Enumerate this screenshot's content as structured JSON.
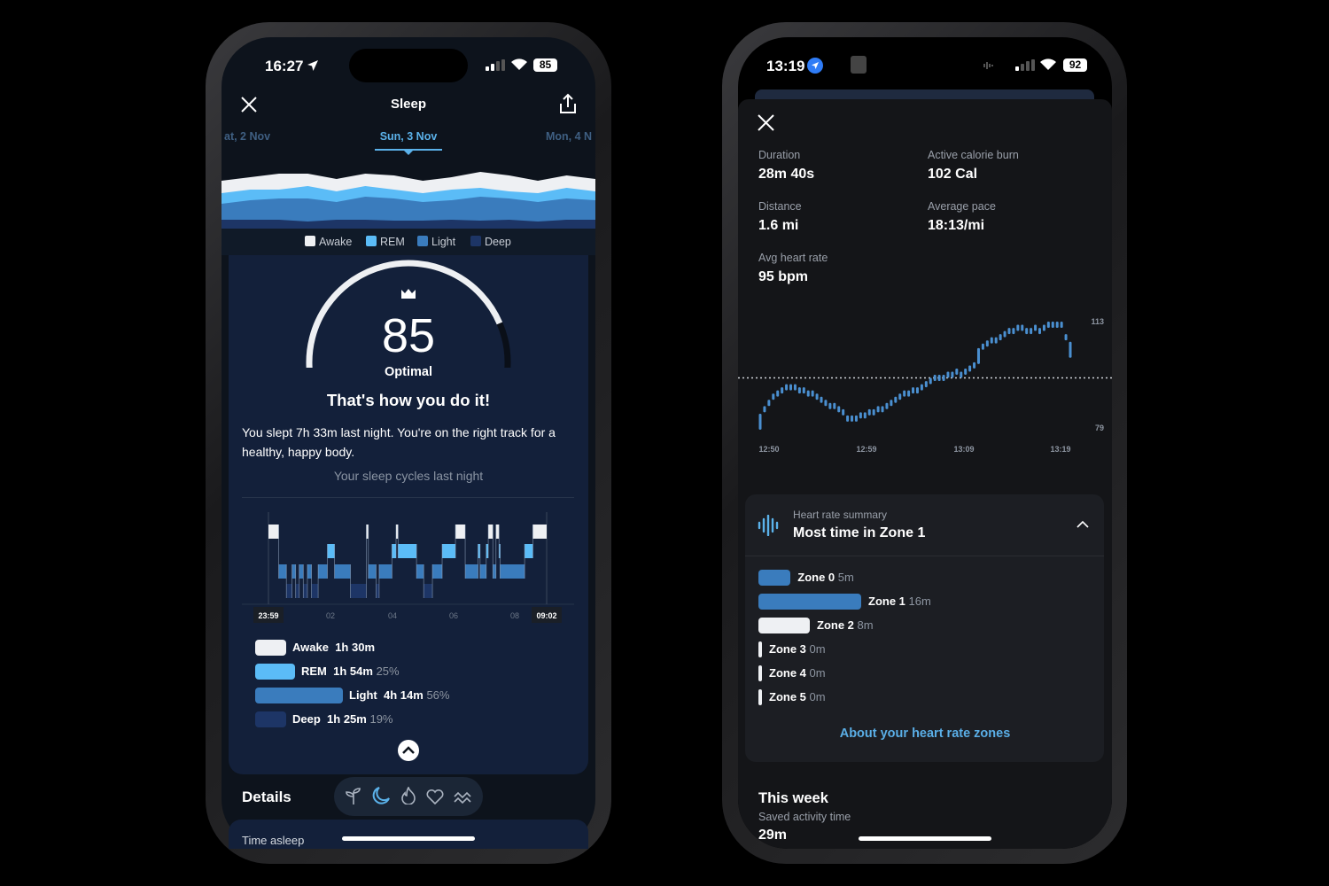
{
  "left_phone": {
    "status": {
      "time": "16:27",
      "battery": "85",
      "location_icon": "location-arrow-icon"
    },
    "header": {
      "title": "Sleep",
      "close_icon": "close-icon",
      "share_icon": "share-icon"
    },
    "date_tabs": [
      {
        "label": "at, 2 Nov",
        "selected": false
      },
      {
        "label": "Sun, 3 Nov",
        "selected": true
      },
      {
        "label": "Mon, 4 N",
        "selected": false
      }
    ],
    "stage_legend": [
      "Awake",
      "REM",
      "Light",
      "Deep"
    ],
    "colors": {
      "awake": "#eef0f3",
      "rem": "#5bbcf7",
      "light": "#3a7cbd",
      "deep": "#1d3566",
      "accent": "#5bb2ea",
      "card": "#13203a"
    },
    "score": {
      "value": 85,
      "max": 100,
      "label": "Optimal",
      "crown_icon": "crown-icon"
    },
    "headline": "That's how you do it!",
    "message": "You slept 7h 33m last night. You're on the right track for a healthy, happy body.",
    "cycles_title": "Your sleep cycles last night",
    "hypnogram": {
      "type": "step",
      "start_label": "23:59",
      "end_label": "09:02",
      "tick_labels": [
        "02",
        "04",
        "06",
        "08"
      ],
      "total_minutes": 543,
      "segments": [
        {
          "start": 0,
          "stage": "awake"
        },
        {
          "start": 20,
          "stage": "light"
        },
        {
          "start": 35,
          "stage": "deep"
        },
        {
          "start": 46,
          "stage": "light"
        },
        {
          "start": 53,
          "stage": "deep"
        },
        {
          "start": 60,
          "stage": "light"
        },
        {
          "start": 68,
          "stage": "deep"
        },
        {
          "start": 76,
          "stage": "light"
        },
        {
          "start": 84,
          "stage": "deep"
        },
        {
          "start": 97,
          "stage": "light"
        },
        {
          "start": 115,
          "stage": "rem"
        },
        {
          "start": 129,
          "stage": "light"
        },
        {
          "start": 160,
          "stage": "deep"
        },
        {
          "start": 191,
          "stage": "awake"
        },
        {
          "start": 195,
          "stage": "light"
        },
        {
          "start": 210,
          "stage": "deep"
        },
        {
          "start": 216,
          "stage": "light"
        },
        {
          "start": 241,
          "stage": "rem"
        },
        {
          "start": 249,
          "stage": "awake"
        },
        {
          "start": 253,
          "stage": "rem"
        },
        {
          "start": 289,
          "stage": "light"
        },
        {
          "start": 303,
          "stage": "deep"
        },
        {
          "start": 320,
          "stage": "light"
        },
        {
          "start": 339,
          "stage": "rem"
        },
        {
          "start": 365,
          "stage": "awake"
        },
        {
          "start": 384,
          "stage": "light"
        },
        {
          "start": 409,
          "stage": "rem"
        },
        {
          "start": 413,
          "stage": "light"
        },
        {
          "start": 425,
          "stage": "rem"
        },
        {
          "start": 429,
          "stage": "awake"
        },
        {
          "start": 438,
          "stage": "light"
        },
        {
          "start": 444,
          "stage": "awake"
        },
        {
          "start": 450,
          "stage": "rem"
        },
        {
          "start": 452,
          "stage": "light"
        },
        {
          "start": 500,
          "stage": "rem"
        },
        {
          "start": 516,
          "stage": "awake"
        }
      ]
    },
    "stage_summary": [
      {
        "stage": "awake",
        "name": "Awake",
        "duration": "1h 30m",
        "percent": null
      },
      {
        "stage": "rem",
        "name": "REM",
        "duration": "1h 54m",
        "percent": "25%"
      },
      {
        "stage": "light",
        "name": "Light",
        "duration": "4h 14m",
        "percent": "56%"
      },
      {
        "stage": "deep",
        "name": "Deep",
        "duration": "1h 25m",
        "percent": "19%"
      }
    ],
    "details": {
      "title": "Details",
      "icons": [
        "sprout-icon",
        "moon-icon",
        "flame-icon",
        "heart-icon",
        "waves-icon"
      ],
      "selected_icon": "moon-icon",
      "next_label": "Time asleep"
    }
  },
  "right_phone": {
    "status": {
      "time": "13:19",
      "battery": "92",
      "location_icon": "location-arrow-icon"
    },
    "close_icon": "close-icon",
    "stats": [
      {
        "label": "Duration",
        "value": "28m 40s"
      },
      {
        "label": "Active calorie burn",
        "value": "102 Cal"
      },
      {
        "label": "Distance",
        "value": "1.6 mi"
      },
      {
        "label": "Average pace",
        "value": "18:13/mi"
      },
      {
        "label": "Avg heart rate",
        "value": "95 bpm"
      }
    ],
    "chart_data": {
      "type": "bar",
      "y_max_label": "113",
      "y_min_label": "79",
      "ylim": [
        79,
        113
      ],
      "average_line": 95,
      "x_labels": [
        "12:50",
        "12:59",
        "13:09",
        "13:19"
      ],
      "values": [
        81,
        85,
        87,
        89,
        90,
        91,
        92,
        92,
        92,
        91,
        91,
        90,
        90,
        89,
        88,
        87,
        86,
        86,
        85,
        84,
        82,
        82,
        82,
        83,
        83,
        84,
        84,
        85,
        85,
        86,
        87,
        88,
        89,
        90,
        90,
        91,
        91,
        92,
        93,
        94,
        95,
        95,
        95,
        96,
        96,
        97,
        96,
        97,
        98,
        99,
        102,
        105,
        106,
        107,
        107,
        108,
        109,
        110,
        110,
        111,
        111,
        110,
        110,
        111,
        110,
        111,
        112,
        112,
        112,
        112,
        108,
        104
      ],
      "color": "#4a8fd0"
    },
    "hr_summary": {
      "label": "Heart rate summary",
      "title": "Most time in Zone 1",
      "icon": "heart-rate-icon",
      "chevron": "chevron-up-icon",
      "zones": [
        {
          "name": "Zone 0",
          "time": "5m",
          "minutes": 5,
          "color": "#3a7cbd"
        },
        {
          "name": "Zone 1",
          "time": "16m",
          "minutes": 16,
          "color": "#3a7cbd"
        },
        {
          "name": "Zone 2",
          "time": "8m",
          "minutes": 8,
          "color": "#eef0f3"
        },
        {
          "name": "Zone 3",
          "time": "0m",
          "minutes": 0,
          "color": "#eef0f3"
        },
        {
          "name": "Zone 4",
          "time": "0m",
          "minutes": 0,
          "color": "#eef0f3"
        },
        {
          "name": "Zone 5",
          "time": "0m",
          "minutes": 0,
          "color": "#eef0f3"
        }
      ],
      "link": "About your heart rate zones"
    },
    "this_week": {
      "title": "This week",
      "label": "Saved activity time",
      "value": "29m"
    }
  }
}
